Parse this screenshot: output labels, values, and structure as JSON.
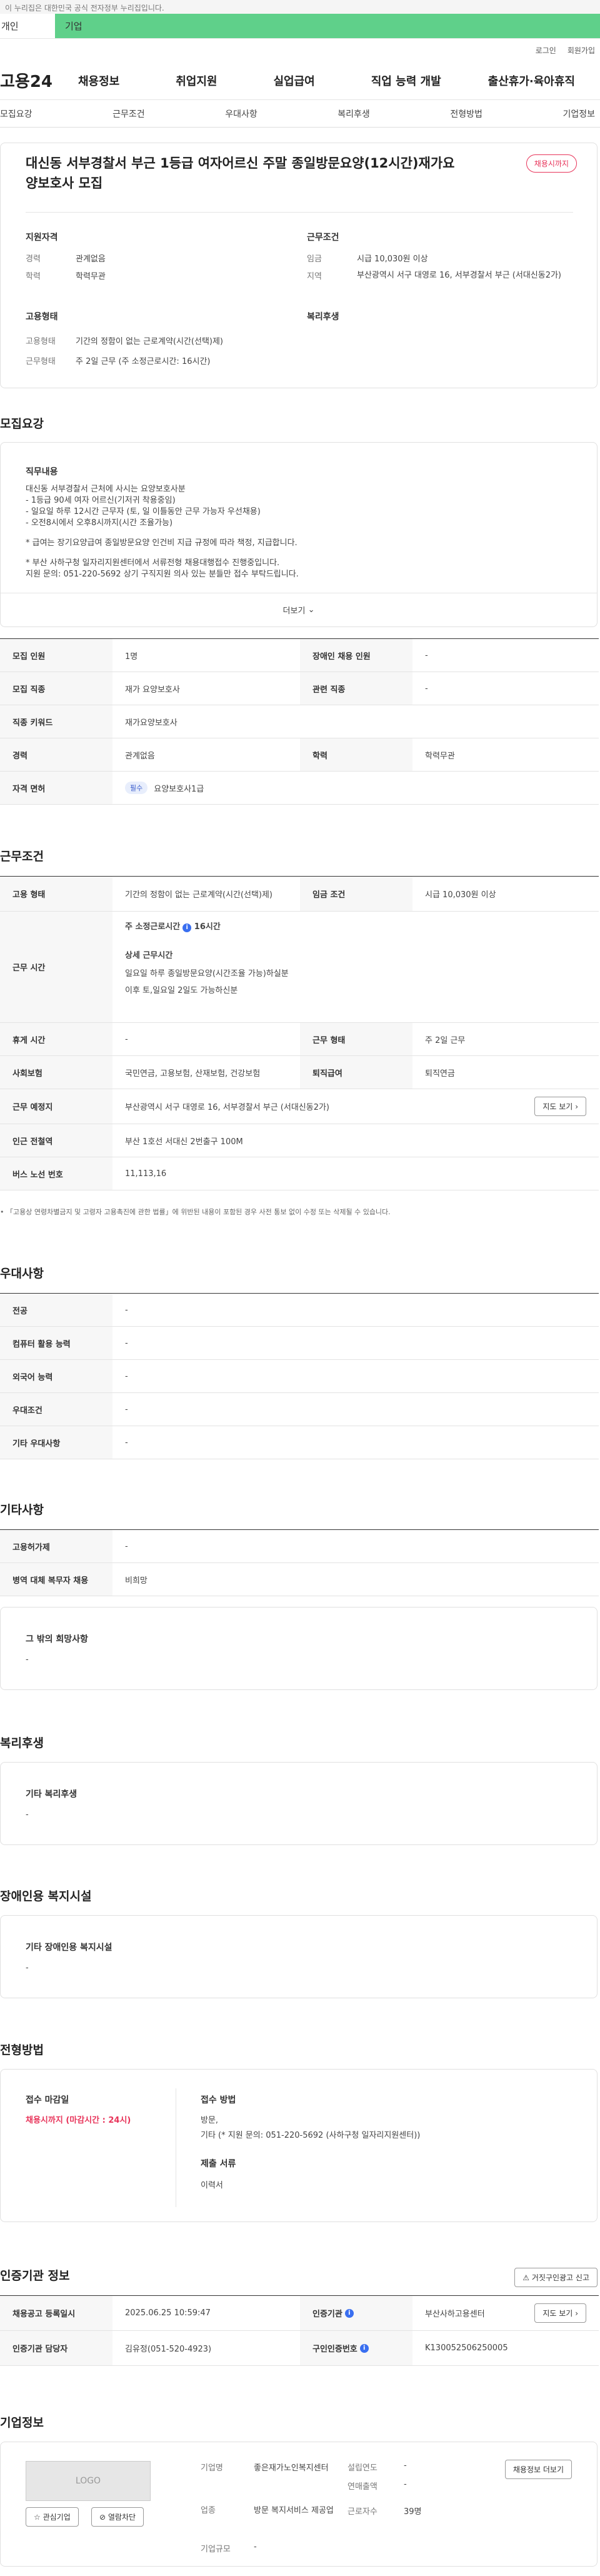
{
  "banner": "이 누리집은 대한민국 공식 전자정부 누리집입니다.",
  "tabs": [
    "개인",
    "기업"
  ],
  "login": [
    "로그인",
    "회원가입"
  ],
  "logo": "고용24",
  "gnb": [
    "채용정보",
    "취업지원",
    "실업급여",
    "직업 능력 개발",
    "출산휴가·육아휴직"
  ],
  "subtabs": [
    "모집요강",
    "근무조건",
    "우대사항",
    "복리후생",
    "전형방법",
    "기업정보"
  ],
  "summary": {
    "title": "대신동 서부경찰서 부근 1등급 여자어르신 주말 종일방문요양(12시간)재가요양보호사 모집",
    "status": "채용시까지",
    "qual_title": "지원자격",
    "cond_title": "근무조건",
    "type_title": "고용형태",
    "welfare_title": "복리후생",
    "career_label": "경력",
    "career": "관계없음",
    "edu_label": "학력",
    "edu": "학력무관",
    "wage_label": "임금",
    "wage": "시급 10,030원 이상",
    "area_label": "지역",
    "area": "부산광역시 서구 대영로 16, 서부경찰서 부근 (서대신동2가)",
    "emp_label": "고용형태",
    "emp": "기간의 정함이 없는 근로계약(시간(선택)제)",
    "form_label": "근무형태",
    "form": "주 2일 근무 (주 소정근로시간: 16시간)"
  },
  "recruit": {
    "title": "모집요강",
    "duty_title": "직무내용",
    "duty_lines": [
      "대신동 서부경찰서 근처에 사시는 요양보호사분",
      "- 1등급 90세 여자 어르신(기저귀 착용중임)",
      "- 일요일 하루 12시간 근무자 (토, 일 이틀동안 근무 가능자 우선채용)",
      "- 오전8시에서 오후8시까지(시간 조율가능)",
      "",
      "* 급여는 장기요양급여 종일방문요양 인건비 지급 규정에 따라 책정, 지급합니다.",
      "",
      "* 부산 사하구청 일자리지원센터에서 서류전형 채용대행접수 진행중입니다.",
      "지원 문의: 051-220-5692 상기 구직지원 의사 있는 분들만 접수 부탁드립니다."
    ],
    "more": "더보기",
    "rows": [
      {
        "k": "모집 인원",
        "v": "1명",
        "k2": "장애인 채용 인원",
        "v2": "-"
      },
      {
        "k": "모집 직종",
        "v": "재가 요양보호사",
        "k2": "관련 직종",
        "v2": "-"
      },
      {
        "k": "직종 키워드",
        "v": "재가요양보호사"
      },
      {
        "k": "경력",
        "v": "관계없음",
        "k2": "학력",
        "v2": "학력무관"
      },
      {
        "k": "자격 면허",
        "pill": "필수",
        "v": "요양보호사1급"
      }
    ]
  },
  "work": {
    "title": "근무조건",
    "emp_k": "고용 형태",
    "emp_v": "기간의 정함이 없는 근로계약(시간(선택)제)",
    "wage_k": "임금 조건",
    "wage_v": "시급 10,030원 이상",
    "time_k": "근무 시간",
    "weekly": "주 소정근로시간",
    "weekly_v": "16시간",
    "detail_title": "상세 근무시간",
    "detail_lines": [
      "일요일 하루 종일방문요양(시간조율 가능)하실분",
      "이후 토,일요일 2일도 가능하신분"
    ],
    "rest_k": "휴게 시간",
    "rest_v": "-",
    "form_k": "근무 형태",
    "form_v": "주 2일 근무",
    "ins_k": "사회보험",
    "ins_v": "국민연금, 고용보험, 산재보험, 건강보험",
    "ret_k": "퇴직급여",
    "ret_v": "퇴직연금",
    "place_k": "근무 예정지",
    "place_v": "부산광역시 서구 대영로 16, 서부경찰서 부근 (서대신동2가)",
    "map": "지도 보기",
    "subway_k": "인근 전철역",
    "subway_v": "부산 1호선 서대신 2번출구 100M",
    "bus_k": "버스 노선 번호",
    "bus_v": "11,113,16",
    "note": "「고용상 연령차별금지 및 고령자 고용촉진에 관한 법률」에 위반된 내용이 포함된 경우 사전 통보 없이 수정 또는 삭제될 수 있습니다."
  },
  "pref": {
    "title": "우대사항",
    "rows": [
      [
        "전공",
        "-"
      ],
      [
        "컴퓨터 활용 능력",
        "-"
      ],
      [
        "외국어 능력",
        "-"
      ],
      [
        "우대조건",
        "-"
      ],
      [
        "기타 우대사항",
        "-"
      ]
    ]
  },
  "etc": {
    "title": "기타사항",
    "rows": [
      [
        "고용허가제",
        "-"
      ],
      [
        "병역 대체 복무자 채용",
        "비희망"
      ]
    ],
    "box_title": "그 밖의 희망사항",
    "box_v": "-"
  },
  "welfare": {
    "title": "복리후생",
    "box_title": "기타 복리후생",
    "box_v": "-"
  },
  "disabled": {
    "title": "장애인용 복지시설",
    "box_title": "기타 장애인용 복지시설",
    "box_v": "-"
  },
  "selection": {
    "title": "전형방법",
    "deadline_t": "접수 마감일",
    "deadline_v": "채용시까지 (마감시간 : 24시)",
    "method_t": "접수 방법",
    "method_v1": "방문,",
    "method_v2": "기타 (* 지원 문의: 051-220-5692 (사하구청 일자리지원센터))",
    "docs_t": "제출 서류",
    "docs_v": "이력서"
  },
  "cert": {
    "title": "인증기관 정보",
    "btn": "거짓구인광고 신고",
    "reg_k": "채용공고 등록일시",
    "reg_v": "2025.06.25 10:59:47",
    "org_k": "인증기관",
    "org_v": "부산사하고용센터",
    "map": "지도 보기",
    "mgr_k": "인증기관 담당자",
    "mgr_v": "김유정(051-520-4923)",
    "no_k": "구인인증번호",
    "no_v": "K130052506250005"
  },
  "company": {
    "title": "기업정보",
    "logo": "LOGO",
    "fav": "관심기업",
    "block": "열람차단",
    "name_k": "기업명",
    "name_v": "좋은재가노인복지센터",
    "year_k": "설립연도",
    "year_v": "-",
    "sales_k": "연매출액",
    "sales_v": "-",
    "ind_k": "업종",
    "ind_v": "방문 복지서비스 제공업",
    "emp_k": "근로자수",
    "emp_v": "39명",
    "size_k": "기업규모",
    "size_v": "-",
    "btn": "채용정보 더보기"
  }
}
